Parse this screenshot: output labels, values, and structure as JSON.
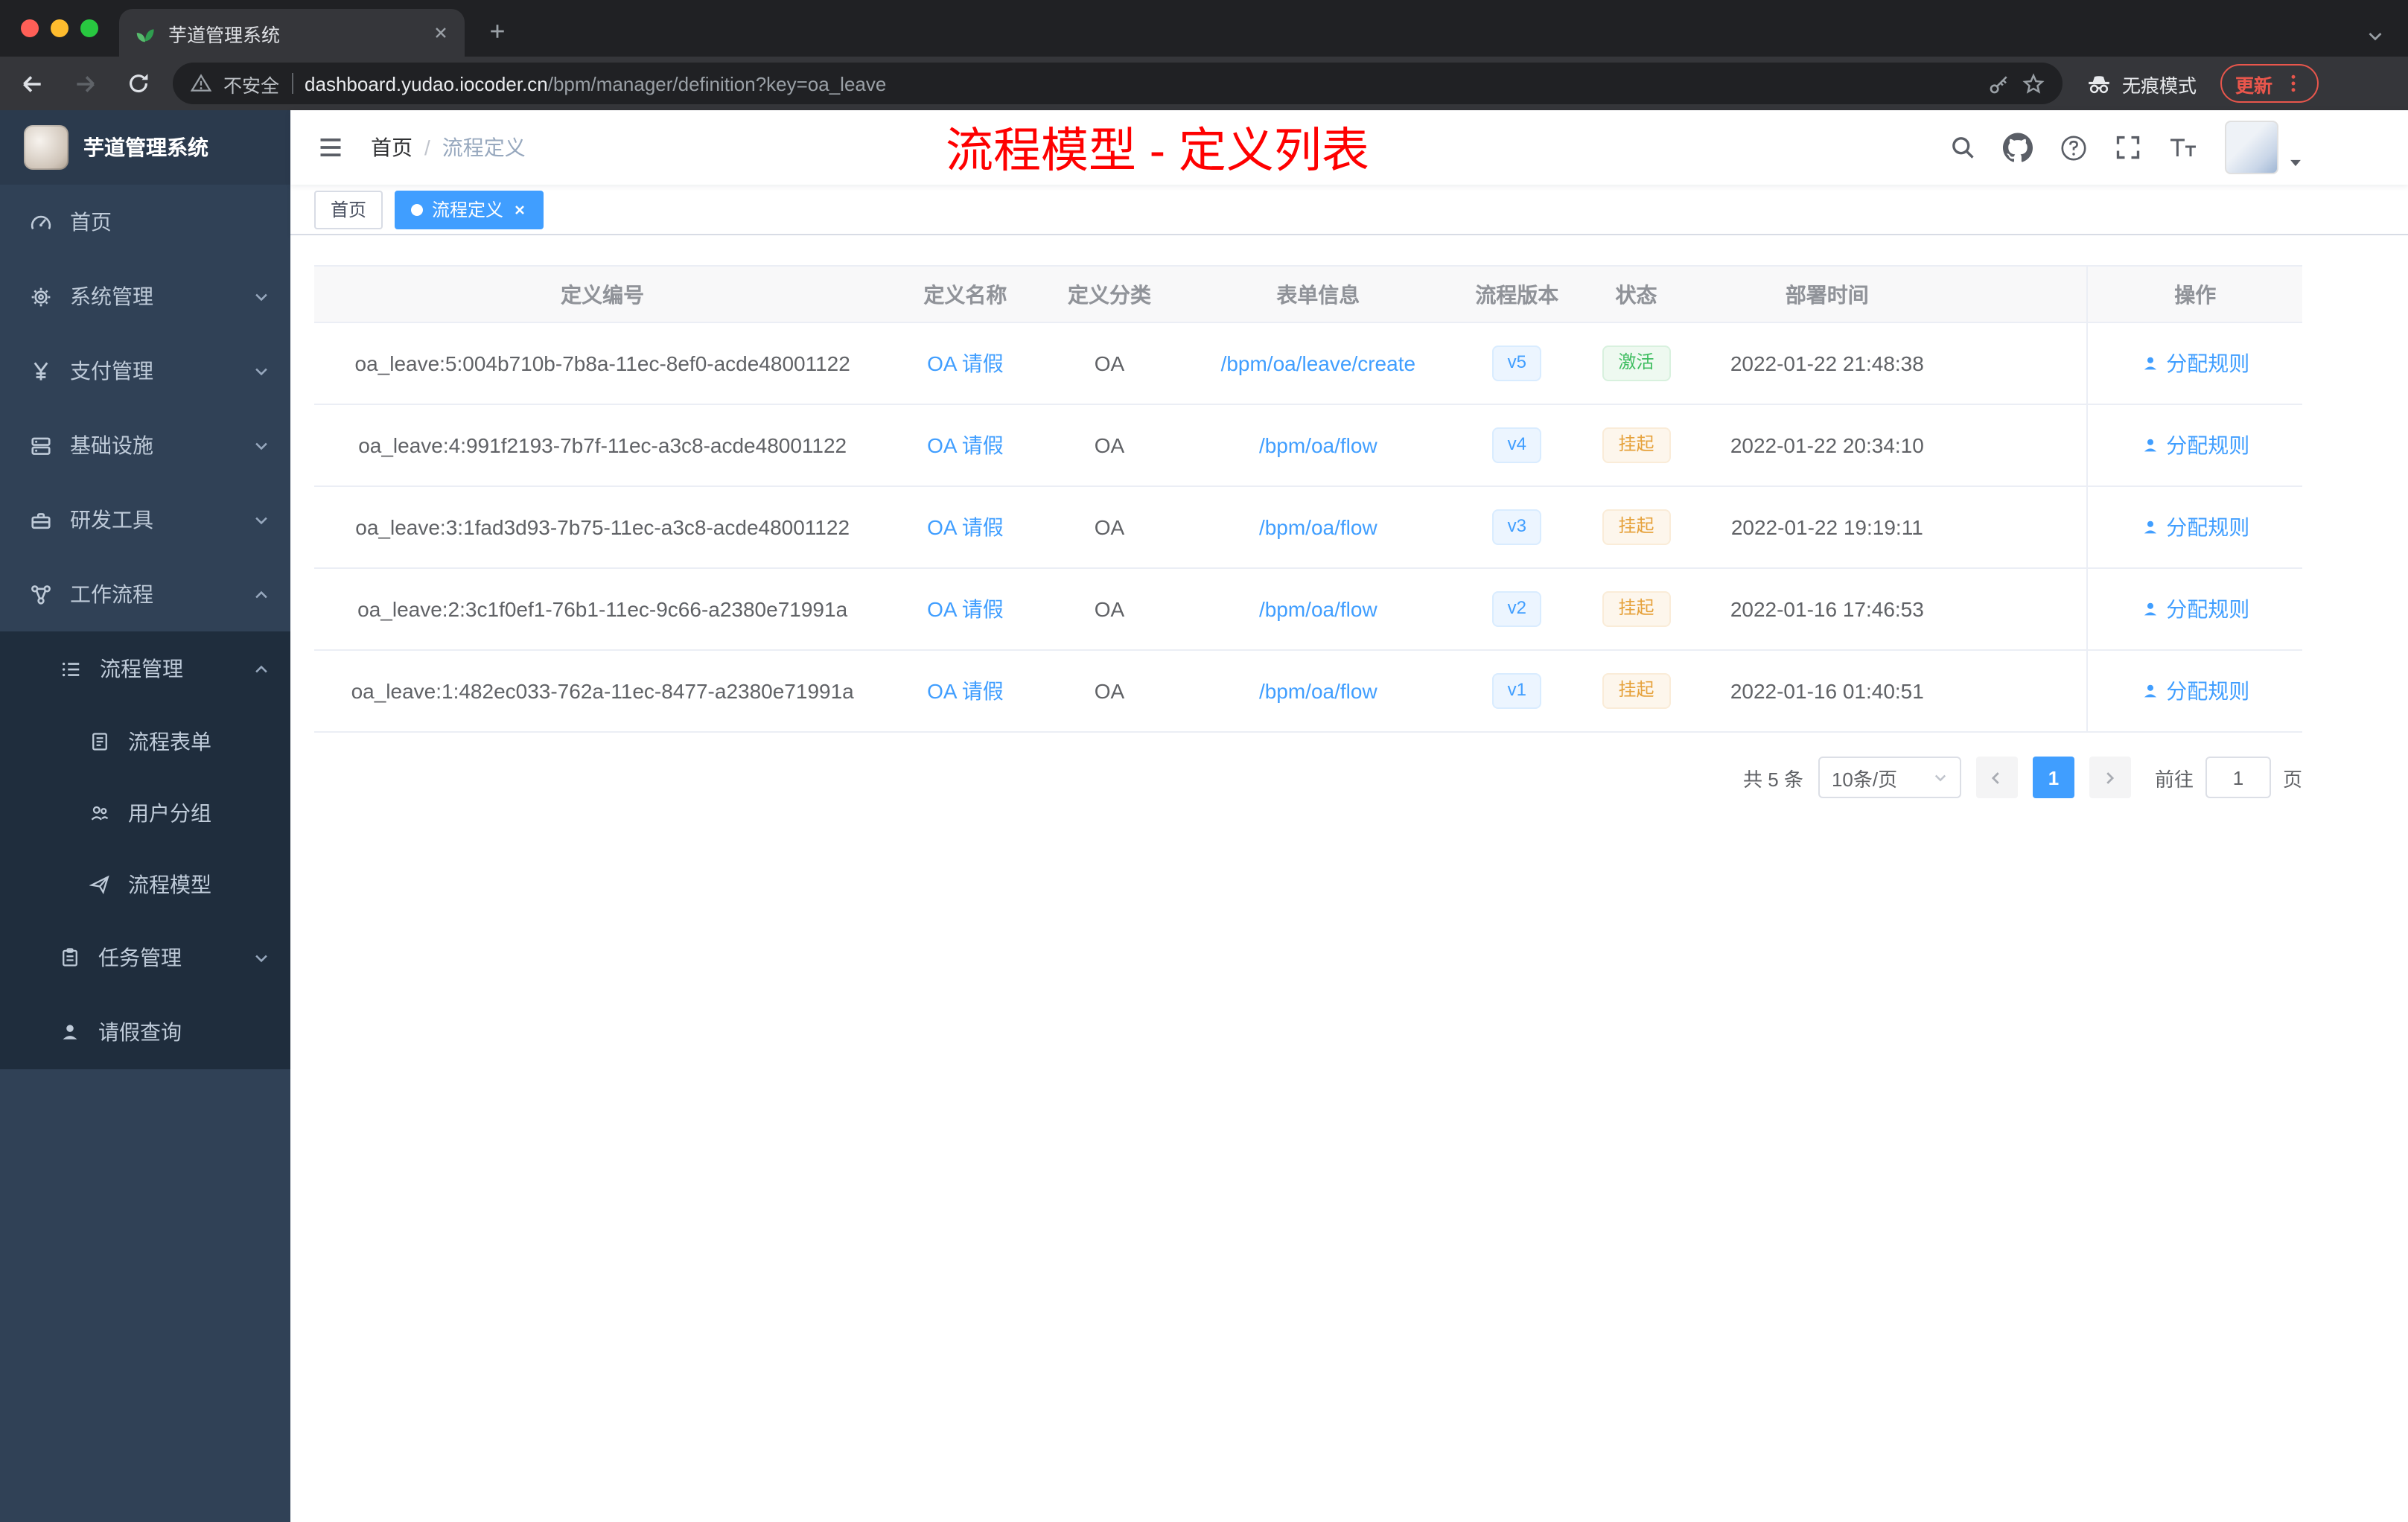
{
  "browser": {
    "tab_title": "芋道管理系统",
    "security_label": "不安全",
    "url_host": "dashboard.yudao.iocoder.cn",
    "url_path": "/bpm/manager/definition?key=oa_leave",
    "incognito_label": "无痕模式",
    "update_label": "更新"
  },
  "sidebar": {
    "logo_title": "芋道管理系统",
    "items": [
      {
        "label": "首页"
      },
      {
        "label": "系统管理"
      },
      {
        "label": "支付管理"
      },
      {
        "label": "基础设施"
      },
      {
        "label": "研发工具"
      },
      {
        "label": "工作流程"
      }
    ],
    "sub": {
      "manage_label": "流程管理",
      "children": [
        {
          "label": "流程表单"
        },
        {
          "label": "用户分组"
        },
        {
          "label": "流程模型"
        }
      ],
      "task_label": "任务管理",
      "leave_label": "请假查询"
    }
  },
  "header": {
    "breadcrumb_home": "首页",
    "breadcrumb_separator": "/",
    "breadcrumb_current": "流程定义",
    "annotation": "流程模型 - 定义列表"
  },
  "tags": {
    "home": "首页",
    "active": "流程定义"
  },
  "table": {
    "headers": [
      "定义编号",
      "定义名称",
      "定义分类",
      "表单信息",
      "流程版本",
      "状态",
      "部署时间",
      "操作"
    ],
    "rows": [
      {
        "id": "oa_leave:5:004b710b-7b8a-11ec-8ef0-acde48001122",
        "name": "OA 请假",
        "category": "OA",
        "form": "/bpm/oa/leave/create",
        "version": "v5",
        "status": "激活",
        "status_type": "success",
        "time": "2022-01-22 21:48:38",
        "action": "分配规则"
      },
      {
        "id": "oa_leave:4:991f2193-7b7f-11ec-a3c8-acde48001122",
        "name": "OA 请假",
        "category": "OA",
        "form": "/bpm/oa/flow",
        "version": "v4",
        "status": "挂起",
        "status_type": "warning",
        "time": "2022-01-22 20:34:10",
        "action": "分配规则"
      },
      {
        "id": "oa_leave:3:1fad3d93-7b75-11ec-a3c8-acde48001122",
        "name": "OA 请假",
        "category": "OA",
        "form": "/bpm/oa/flow",
        "version": "v3",
        "status": "挂起",
        "status_type": "warning",
        "time": "2022-01-22 19:19:11",
        "action": "分配规则"
      },
      {
        "id": "oa_leave:2:3c1f0ef1-76b1-11ec-9c66-a2380e71991a",
        "name": "OA 请假",
        "category": "OA",
        "form": "/bpm/oa/flow",
        "version": "v2",
        "status": "挂起",
        "status_type": "warning",
        "time": "2022-01-16 17:46:53",
        "action": "分配规则"
      },
      {
        "id": "oa_leave:1:482ec033-762a-11ec-8477-a2380e71991a",
        "name": "OA 请假",
        "category": "OA",
        "form": "/bpm/oa/flow",
        "version": "v1",
        "status": "挂起",
        "status_type": "warning",
        "time": "2022-01-16 01:40:51",
        "action": "分配规则"
      }
    ]
  },
  "pagination": {
    "total": "共 5 条",
    "page_size": "10条/页",
    "current_page": "1",
    "goto_label": "前往",
    "goto_value": "1",
    "goto_unit": "页"
  },
  "colors": {
    "accent": "#409eff",
    "status_active": "#3dbd5f",
    "status_suspended": "#e6a23c",
    "annotation_red": "#fe0000"
  }
}
